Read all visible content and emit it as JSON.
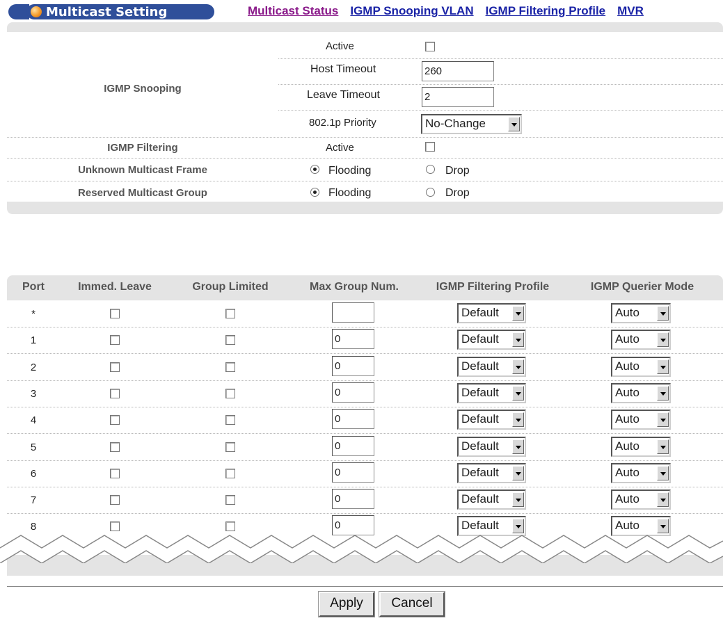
{
  "header": {
    "title": "Multicast Setting",
    "nav": [
      {
        "label": "Multicast Status"
      },
      {
        "label": "IGMP Snooping VLAN"
      },
      {
        "label": "IGMP Filtering Profile"
      },
      {
        "label": "MVR"
      }
    ]
  },
  "settings": {
    "igmp_snooping_label": "IGMP Snooping",
    "active_label": "Active",
    "active_checked": false,
    "host_timeout_label": "Host Timeout",
    "host_timeout_value": "260",
    "leave_timeout_label": "Leave Timeout",
    "leave_timeout_value": "2",
    "priority_label": "802.1p Priority",
    "priority_value": "No-Change",
    "igmp_filtering_label": "IGMP Filtering",
    "filtering_active_label": "Active",
    "filtering_active_checked": false,
    "unknown_multicast_label": "Unknown Multicast Frame",
    "unknown_flooding_label": "Flooding",
    "unknown_drop_label": "Drop",
    "unknown_selected": "Flooding",
    "reserved_multicast_label": "Reserved Multicast Group",
    "reserved_flooding_label": "Flooding",
    "reserved_drop_label": "Drop",
    "reserved_selected": "Flooding"
  },
  "port_table": {
    "headers": {
      "port": "Port",
      "immed_leave": "Immed. Leave",
      "group_limited": "Group Limited",
      "max_group_num": "Max Group Num.",
      "filtering_profile": "IGMP Filtering Profile",
      "querier_mode": "IGMP Querier Mode"
    },
    "rows": [
      {
        "port": "*",
        "immed_leave": false,
        "group_limited": false,
        "max_group_num": "",
        "profile": "Default",
        "querier": "Auto"
      },
      {
        "port": "1",
        "immed_leave": false,
        "group_limited": false,
        "max_group_num": "0",
        "profile": "Default",
        "querier": "Auto"
      },
      {
        "port": "2",
        "immed_leave": false,
        "group_limited": false,
        "max_group_num": "0",
        "profile": "Default",
        "querier": "Auto"
      },
      {
        "port": "3",
        "immed_leave": false,
        "group_limited": false,
        "max_group_num": "0",
        "profile": "Default",
        "querier": "Auto"
      },
      {
        "port": "4",
        "immed_leave": false,
        "group_limited": false,
        "max_group_num": "0",
        "profile": "Default",
        "querier": "Auto"
      },
      {
        "port": "5",
        "immed_leave": false,
        "group_limited": false,
        "max_group_num": "0",
        "profile": "Default",
        "querier": "Auto"
      },
      {
        "port": "6",
        "immed_leave": false,
        "group_limited": false,
        "max_group_num": "0",
        "profile": "Default",
        "querier": "Auto"
      },
      {
        "port": "7",
        "immed_leave": false,
        "group_limited": false,
        "max_group_num": "0",
        "profile": "Default",
        "querier": "Auto"
      },
      {
        "port": "8",
        "immed_leave": false,
        "group_limited": false,
        "max_group_num": "0",
        "profile": "Default",
        "querier": "Auto"
      }
    ]
  },
  "buttons": {
    "apply": "Apply",
    "cancel": "Cancel"
  },
  "colors": {
    "title_bar": "#2f4f9a",
    "link": "#1a23a6",
    "visited_link": "#8a1a8a",
    "panel_gray": "#e4e4e4"
  }
}
